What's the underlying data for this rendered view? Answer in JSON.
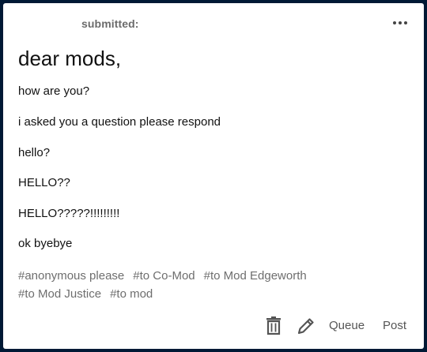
{
  "post": {
    "submitted_label": "submitted:",
    "title": "dear mods,",
    "lines": [
      "how are you?",
      "i asked you a question please respond",
      "hello?",
      "HELLO??",
      "HELLO?????!!!!!!!!!",
      "ok byebye"
    ],
    "tags": [
      "#anonymous please",
      "#to Co-Mod",
      "#to Mod Edgeworth",
      "#to Mod Justice",
      "#to mod"
    ]
  },
  "actions": {
    "more_icon": "more-horizontal-icon",
    "trash_icon": "trash-icon",
    "edit_icon": "pencil-icon",
    "queue_label": "Queue",
    "post_label": "Post"
  },
  "colors": {
    "background": "#001935",
    "card": "#ffffff",
    "muted_text": "#6e6e6e",
    "icon": "#555555"
  }
}
